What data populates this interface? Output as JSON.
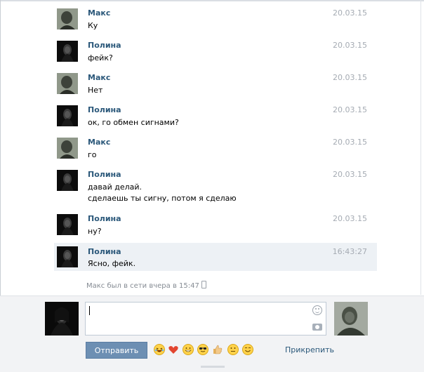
{
  "messages": [
    {
      "author": "Макс",
      "date": "20.03.15",
      "lines": [
        "Ку"
      ],
      "avatar": "maks-avatar"
    },
    {
      "author": "Полина",
      "date": "20.03.15",
      "lines": [
        "фейк?"
      ],
      "avatar": "polina-avatar"
    },
    {
      "author": "Макс",
      "date": "20.03.15",
      "lines": [
        "Нет"
      ],
      "avatar": "maks-avatar"
    },
    {
      "author": "Полина",
      "date": "20.03.15",
      "lines": [
        "ок, го обмен сигнами?"
      ],
      "avatar": "polina-avatar"
    },
    {
      "author": "Макс",
      "date": "20.03.15",
      "lines": [
        "го"
      ],
      "avatar": "maks-avatar"
    },
    {
      "author": "Полина",
      "date": "20.03.15",
      "lines": [
        "давай делай.",
        "сделаешь ты сигну, потом я сделаю"
      ],
      "avatar": "polina-avatar"
    },
    {
      "author": "Полина",
      "date": "20.03.15",
      "lines": [
        "ну?"
      ],
      "avatar": "polina-avatar"
    },
    {
      "author": "Полина",
      "date": "16:43:27",
      "lines": [
        "Ясно, фейк."
      ],
      "avatar": "polina-avatar",
      "highlighted": true
    }
  ],
  "status": "Макс был в сети вчера в 15:47",
  "composer": {
    "value": "",
    "send_label": "Отправить",
    "attach_label": "Прикрепить",
    "emoji": [
      "laughing-emoji",
      "heart-emoji",
      "grin-emoji",
      "sunglasses-emoji",
      "thumbs-up-emoji",
      "neutral-emoji",
      "smile-emoji"
    ]
  },
  "colors": {
    "author": "#2b587a",
    "date": "#a5abb3",
    "highlight": "#edf1f5",
    "send_button": "#6d8fb3",
    "composer_bg": "#f2f3f5"
  }
}
